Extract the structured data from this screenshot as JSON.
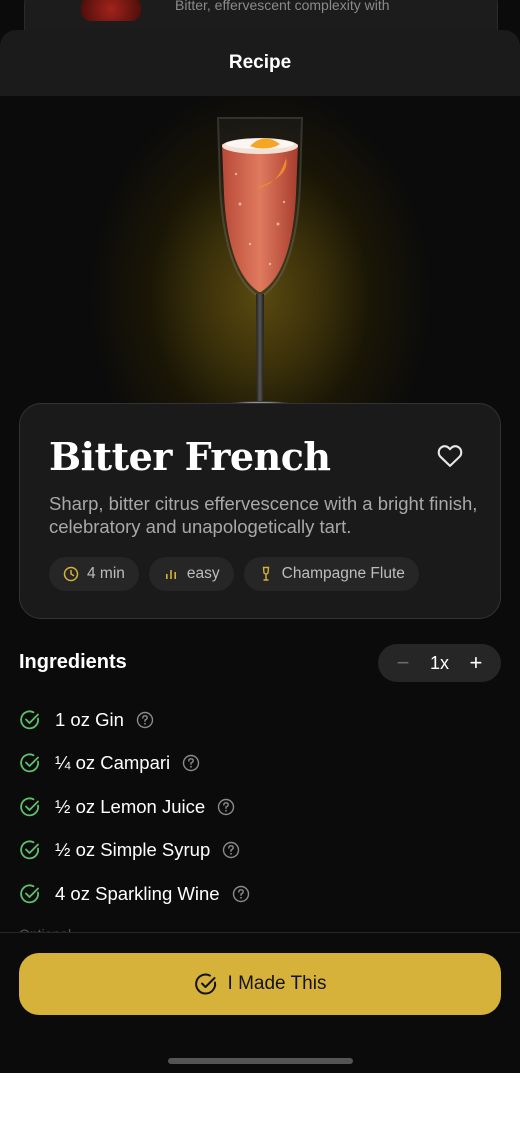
{
  "background_card": {
    "text": "Bitter, effervescent complexity with"
  },
  "header": {
    "title": "Recipe"
  },
  "recipe": {
    "name": "Bitter French",
    "description": "Sharp, bitter citrus effervescence with a bright finish, celebratory and unapologetically tart.",
    "chips": [
      {
        "icon": "clock-icon",
        "label": "4 min"
      },
      {
        "icon": "bars-icon",
        "label": "easy"
      },
      {
        "icon": "champagne-glass-icon",
        "label": "Champagne Flute"
      }
    ]
  },
  "ingredients": {
    "title": "Ingredients",
    "servings_value": "1x",
    "items": [
      {
        "label": "1 oz Gin"
      },
      {
        "label": "¼ oz Campari"
      },
      {
        "label": "½ oz Lemon Juice"
      },
      {
        "label": "½ oz Simple Syrup"
      },
      {
        "label": "4 oz Sparkling Wine"
      }
    ],
    "next_section_hint": "Optional"
  },
  "actions": {
    "made_this_label": "I Made This"
  },
  "colors": {
    "accent": "#d6b23b",
    "check": "#5fbf6a",
    "background": "#0b0b0b",
    "card": "#1a1a1a"
  }
}
